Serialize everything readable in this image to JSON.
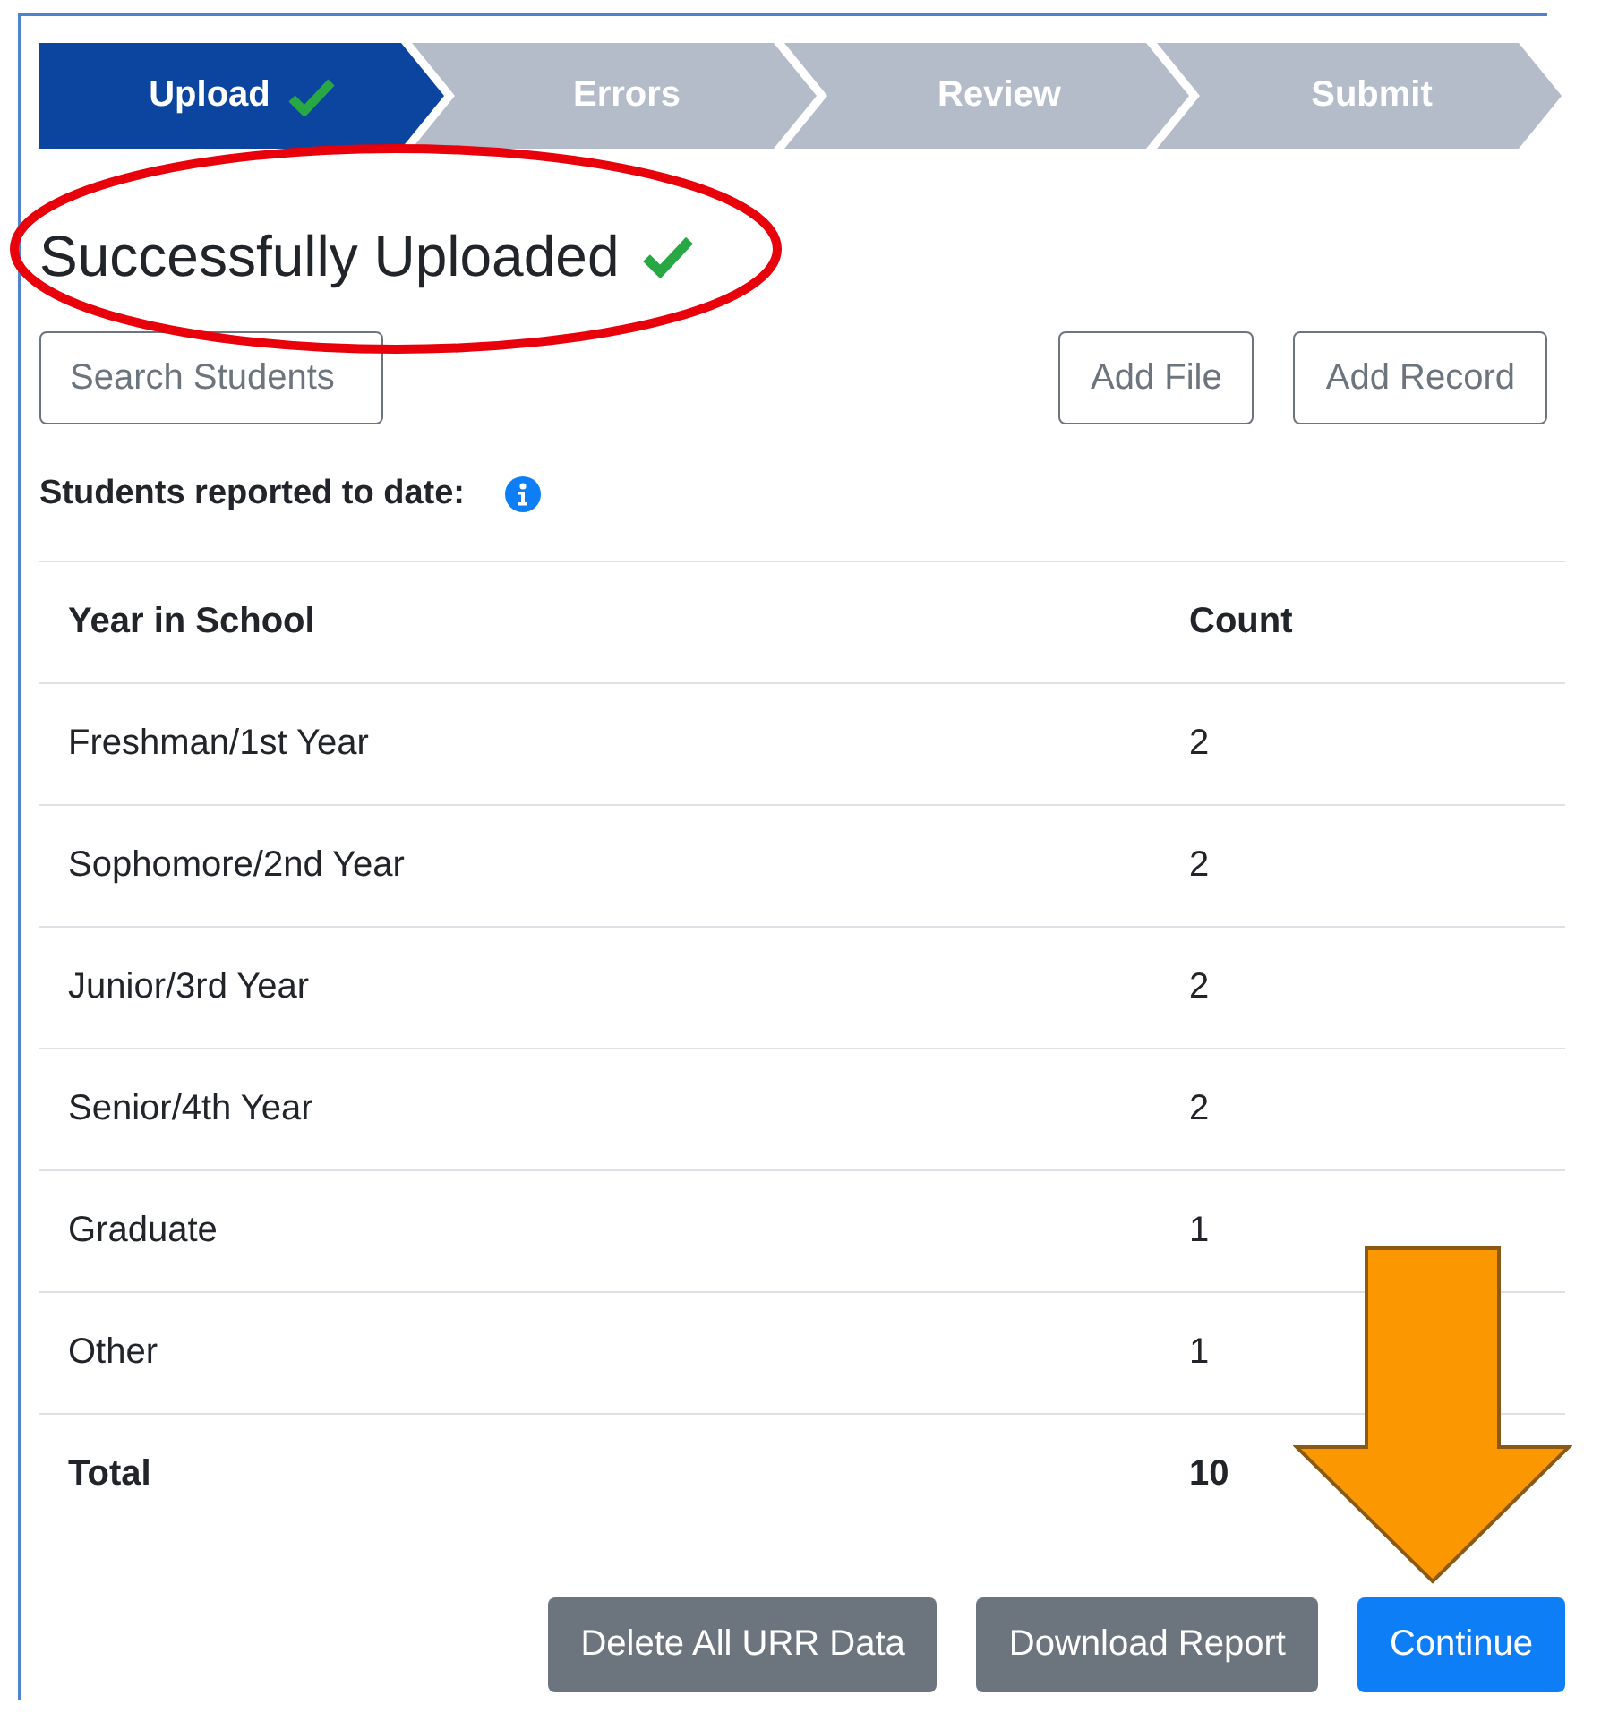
{
  "steps": [
    {
      "label": "Upload",
      "selected": true,
      "done": true
    },
    {
      "label": "Errors",
      "selected": false,
      "done": false
    },
    {
      "label": "Review",
      "selected": false,
      "done": false
    },
    {
      "label": "Submit",
      "selected": false,
      "done": false
    }
  ],
  "heading": {
    "title": "Successfully Uploaded",
    "success": true
  },
  "search": {
    "placeholder": "Search Students"
  },
  "toolbar_buttons": [
    "Add File",
    "Add Record"
  ],
  "summary_label": "Students reported to date:",
  "table": {
    "columns": [
      "Year in School",
      "Count"
    ],
    "rows": [
      {
        "kind": "data",
        "cells": [
          "Freshman/1st Year",
          "2"
        ]
      },
      {
        "kind": "data",
        "cells": [
          "Sophomore/2nd Year",
          "2"
        ]
      },
      {
        "kind": "data",
        "cells": [
          "Junior/3rd Year",
          "2"
        ]
      },
      {
        "kind": "data",
        "cells": [
          "Senior/4th Year",
          "2"
        ]
      },
      {
        "kind": "data",
        "cells": [
          "Graduate",
          "1"
        ]
      },
      {
        "kind": "data",
        "cells": [
          "Other",
          "1"
        ]
      },
      {
        "kind": "total",
        "cells": [
          "Total",
          "10"
        ]
      }
    ]
  },
  "footer_buttons": [
    {
      "label": "Delete All URR Data",
      "kind": "secondary"
    },
    {
      "label": "Download Report",
      "kind": "secondary"
    },
    {
      "label": "Continue",
      "kind": "primary"
    }
  ]
}
